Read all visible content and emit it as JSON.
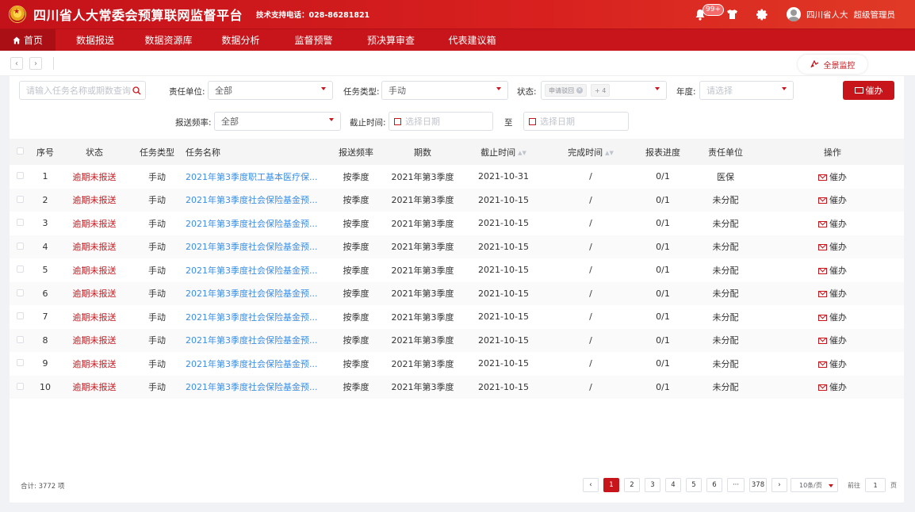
{
  "header": {
    "title": "四川省人大常委会预算联网监督平台",
    "support": "技术支持电话：028-86281821",
    "badge": "99+",
    "user_name": "四川省人大",
    "user_role": "超级管理员",
    "brand_color": "#c8151b"
  },
  "nav": {
    "items": [
      {
        "label": "首页",
        "icon": "home-icon"
      },
      {
        "label": "数据报送"
      },
      {
        "label": "数据资源库"
      },
      {
        "label": "数据分析"
      },
      {
        "label": "监督预警"
      },
      {
        "label": "预决算审查"
      },
      {
        "label": "代表建议箱"
      }
    ]
  },
  "tabs": {
    "monitor_label": "全景监控"
  },
  "filters": {
    "search_placeholder": "请输入任务名称或期数查询",
    "unit_label": "责任单位:",
    "unit_value": "全部",
    "type_label": "任务类型:",
    "type_value": "手动",
    "status_label": "状态:",
    "status_tag": "申请驳回",
    "status_more": "+ 4",
    "year_label": "年度:",
    "year_placeholder": "请选择",
    "freq_label": "报送频率:",
    "freq_value": "全部",
    "deadline_label": "截止时间:",
    "date_placeholder_start": "选择日期",
    "to_label": "至",
    "date_placeholder_end": "选择日期",
    "urge_label": "催办"
  },
  "table": {
    "headers": {
      "seq": "序号",
      "status": "状态",
      "type": "任务类型",
      "name": "任务名称",
      "freq": "报送频率",
      "period": "期数",
      "deadline": "截止时间",
      "finish": "完成时间",
      "progress": "报表进度",
      "unit": "责任单位",
      "op": "操作"
    },
    "op_label": "催办",
    "rows": [
      {
        "seq": "1",
        "status": "逾期未报送",
        "type": "手动",
        "name": "2021年第3季度职工基本医疗保...",
        "freq": "按季度",
        "period": "2021年第3季度",
        "deadline": "2021-10-31",
        "finish": "/",
        "progress": "0/1",
        "unit": "医保"
      },
      {
        "seq": "2",
        "status": "逾期未报送",
        "type": "手动",
        "name": "2021年第3季度社会保险基金预...",
        "freq": "按季度",
        "period": "2021年第3季度",
        "deadline": "2021-10-15",
        "finish": "/",
        "progress": "0/1",
        "unit": "未分配"
      },
      {
        "seq": "3",
        "status": "逾期未报送",
        "type": "手动",
        "name": "2021年第3季度社会保险基金预...",
        "freq": "按季度",
        "period": "2021年第3季度",
        "deadline": "2021-10-15",
        "finish": "/",
        "progress": "0/1",
        "unit": "未分配"
      },
      {
        "seq": "4",
        "status": "逾期未报送",
        "type": "手动",
        "name": "2021年第3季度社会保险基金预...",
        "freq": "按季度",
        "period": "2021年第3季度",
        "deadline": "2021-10-15",
        "finish": "/",
        "progress": "0/1",
        "unit": "未分配"
      },
      {
        "seq": "5",
        "status": "逾期未报送",
        "type": "手动",
        "name": "2021年第3季度社会保险基金预...",
        "freq": "按季度",
        "period": "2021年第3季度",
        "deadline": "2021-10-15",
        "finish": "/",
        "progress": "0/1",
        "unit": "未分配"
      },
      {
        "seq": "6",
        "status": "逾期未报送",
        "type": "手动",
        "name": "2021年第3季度社会保险基金预...",
        "freq": "按季度",
        "period": "2021年第3季度",
        "deadline": "2021-10-15",
        "finish": "/",
        "progress": "0/1",
        "unit": "未分配"
      },
      {
        "seq": "7",
        "status": "逾期未报送",
        "type": "手动",
        "name": "2021年第3季度社会保险基金预...",
        "freq": "按季度",
        "period": "2021年第3季度",
        "deadline": "2021-10-15",
        "finish": "/",
        "progress": "0/1",
        "unit": "未分配"
      },
      {
        "seq": "8",
        "status": "逾期未报送",
        "type": "手动",
        "name": "2021年第3季度社会保险基金预...",
        "freq": "按季度",
        "period": "2021年第3季度",
        "deadline": "2021-10-15",
        "finish": "/",
        "progress": "0/1",
        "unit": "未分配"
      },
      {
        "seq": "9",
        "status": "逾期未报送",
        "type": "手动",
        "name": "2021年第3季度社会保险基金预...",
        "freq": "按季度",
        "period": "2021年第3季度",
        "deadline": "2021-10-15",
        "finish": "/",
        "progress": "0/1",
        "unit": "未分配"
      },
      {
        "seq": "10",
        "status": "逾期未报送",
        "type": "手动",
        "name": "2021年第3季度社会保险基金预...",
        "freq": "按季度",
        "period": "2021年第3季度",
        "deadline": "2021-10-15",
        "finish": "/",
        "progress": "0/1",
        "unit": "未分配"
      }
    ]
  },
  "footer": {
    "total": "合计: 3772 项",
    "pages": [
      "1",
      "2",
      "3",
      "4",
      "5",
      "6",
      "···",
      "378"
    ],
    "active_page": "1",
    "prev": "‹",
    "next": "›",
    "page_size": "10条/页",
    "goto_label": "前往",
    "goto_value": "1",
    "page_unit": "页"
  }
}
